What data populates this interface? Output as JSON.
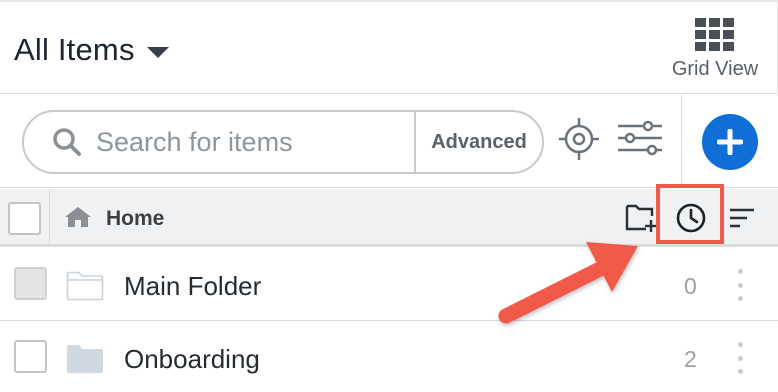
{
  "header": {
    "title": "All Items",
    "view_toggle_label": "Grid View"
  },
  "toolbar": {
    "search_placeholder": "Search for items",
    "advanced_label": "Advanced"
  },
  "list_header": {
    "breadcrumb_home": "Home"
  },
  "rows": [
    {
      "name": "Main Folder",
      "count": "0"
    },
    {
      "name": "Onboarding",
      "count": "2"
    }
  ],
  "colors": {
    "accent_blue": "#0f6fd6",
    "highlight_red": "#f15a4a"
  },
  "icons": {
    "grid": "grid-view-icon",
    "search": "search-icon",
    "target": "locate-target-icon",
    "filter": "filter-sliders-icon",
    "add": "plus-icon",
    "home": "home-icon",
    "new_folder": "new-folder-icon",
    "recent": "clock-icon",
    "sort": "sort-icon",
    "folder": "folder-icon",
    "more": "kebab-menu-icon"
  }
}
